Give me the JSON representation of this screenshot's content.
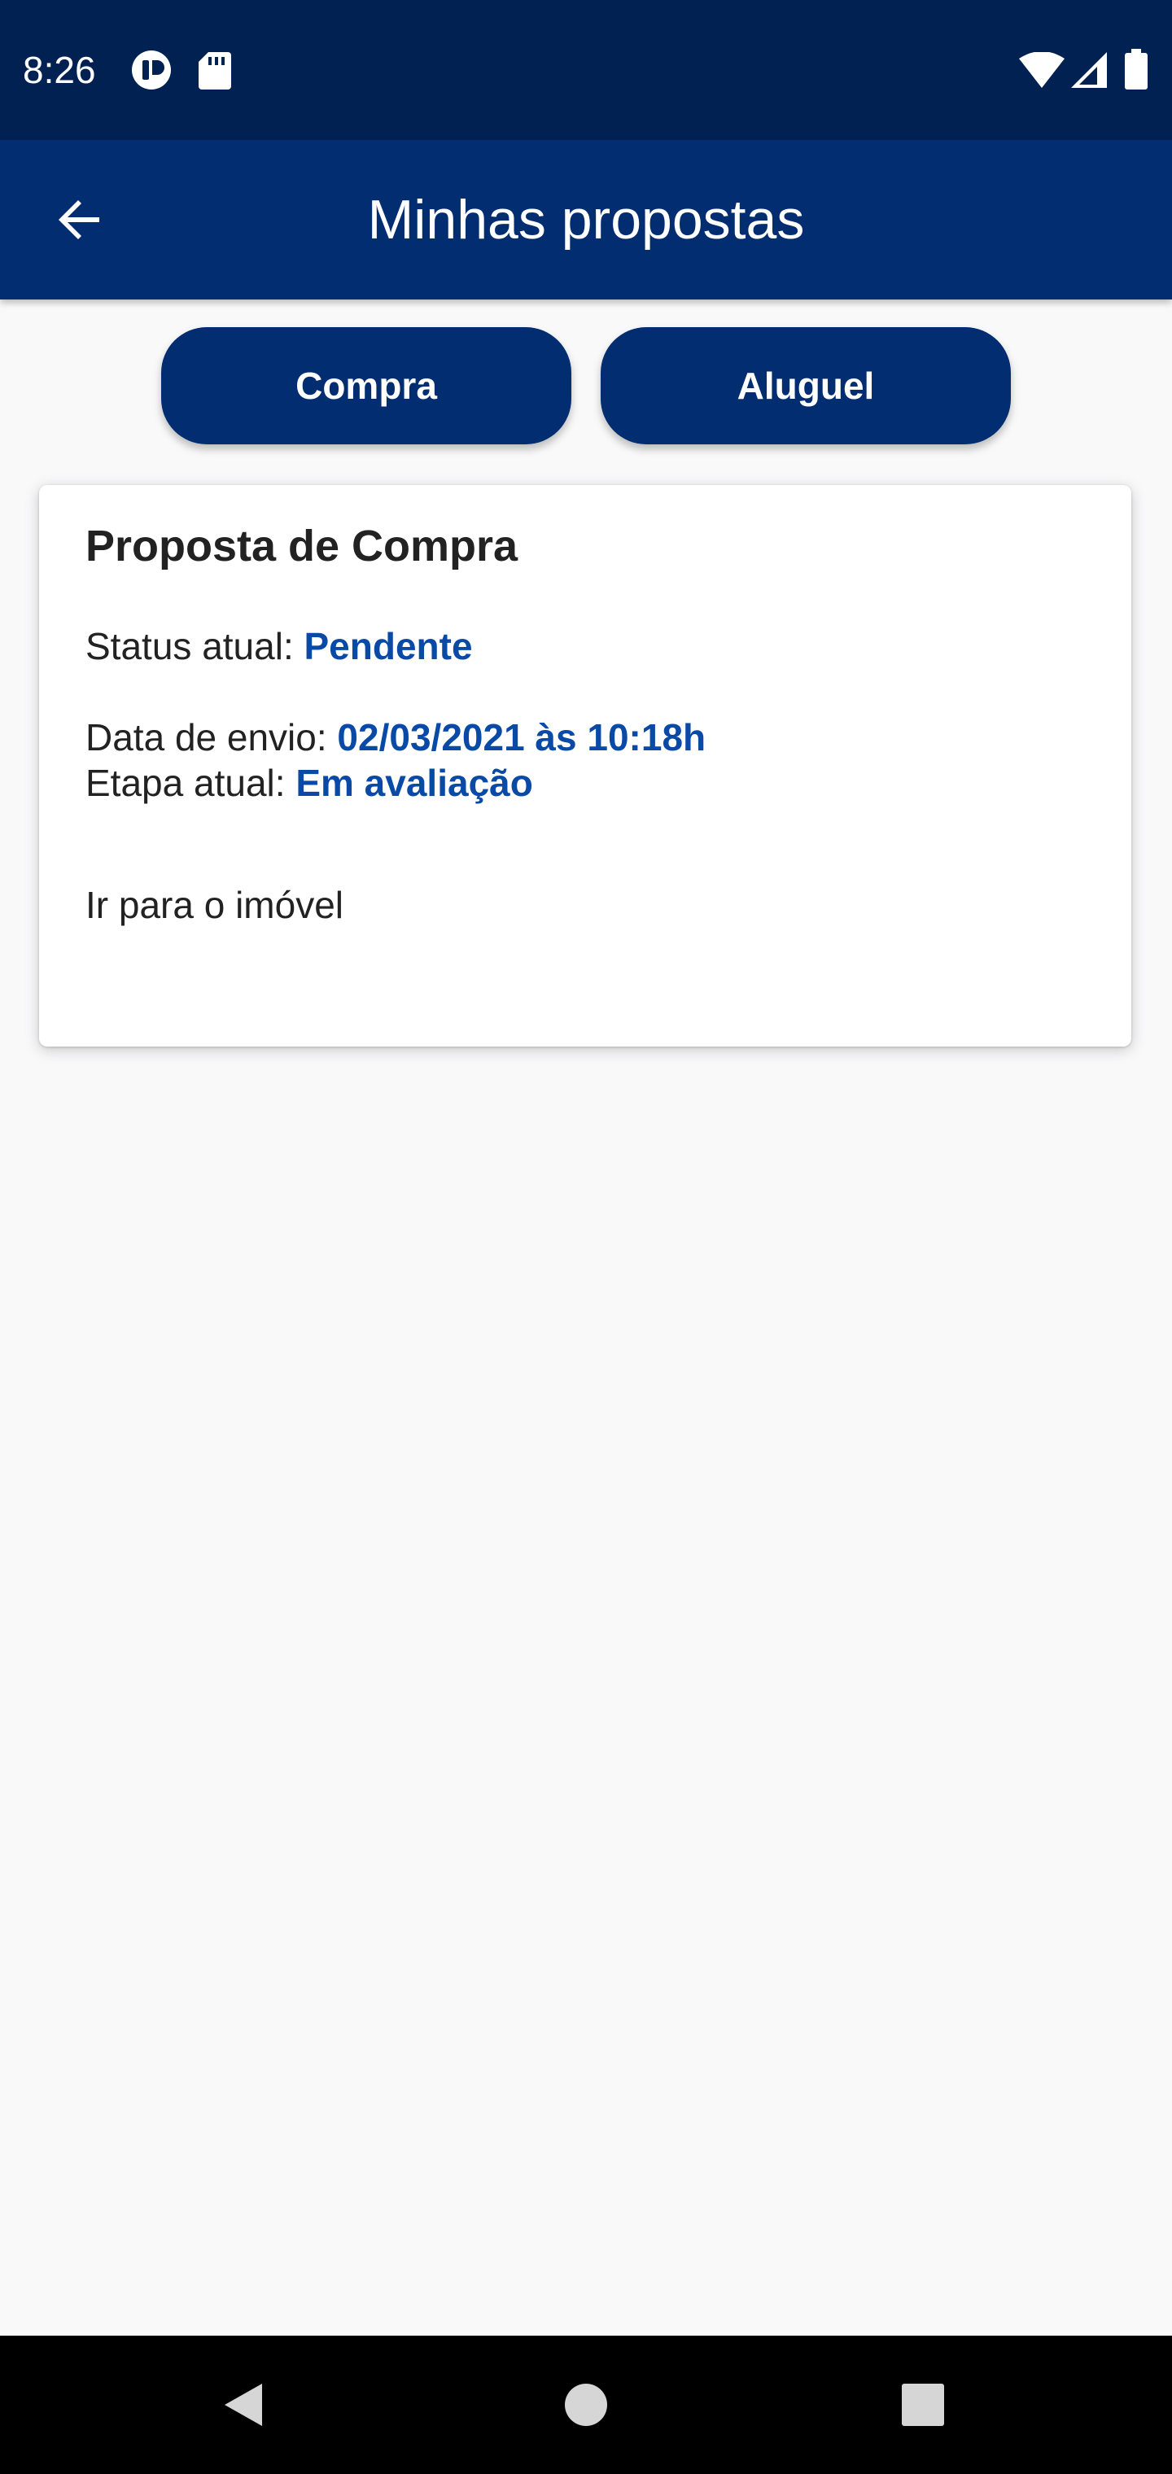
{
  "status_bar": {
    "time": "8:26",
    "icons": [
      "media-app-icon",
      "sd-card-icon",
      "wifi-icon",
      "signal-icon",
      "battery-icon"
    ]
  },
  "app_bar": {
    "title": "Minhas propostas",
    "back_icon": "arrow-back-icon",
    "background_color": "#022d71"
  },
  "tabs": [
    {
      "label": "Compra"
    },
    {
      "label": "Aluguel"
    }
  ],
  "proposal_card": {
    "title": "Proposta de Compra",
    "status_label": "Status atual: ",
    "status_value": "Pendente",
    "sent_label": "Data de envio: ",
    "sent_value": "02/03/2021 às 10:18h",
    "stage_label": "Etapa atual: ",
    "stage_value": "Em avaliação",
    "link_label": "Ir para o imóvel",
    "accent_color": "#0a4aa7"
  },
  "nav_bar": {
    "icons": [
      "nav-back-icon",
      "nav-home-icon",
      "nav-recents-icon"
    ]
  }
}
